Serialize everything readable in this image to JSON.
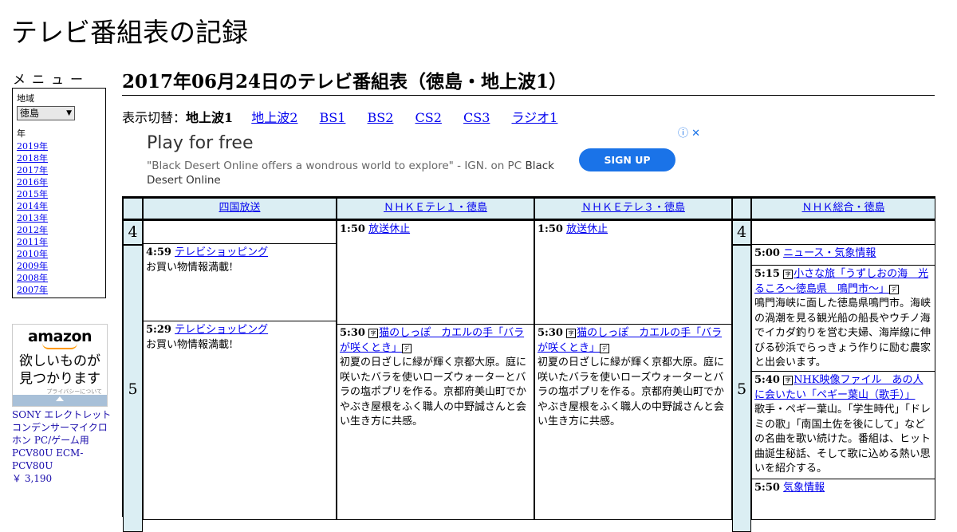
{
  "site": {
    "title": "テレビ番組表の記録"
  },
  "menu": {
    "label": "メニュー",
    "region_label": "地域",
    "region_value": "徳島",
    "year_label": "年",
    "years": [
      "2019年",
      "2018年",
      "2017年",
      "2016年",
      "2015年",
      "2014年",
      "2013年",
      "2012年",
      "2011年",
      "2010年",
      "2009年",
      "2008年",
      "2007年"
    ]
  },
  "amazon_ad": {
    "logo": "amazon",
    "tagline_1": "欲しいものが",
    "tagline_2": "見つかります",
    "privacy": "プライバシーについて",
    "product_name": "SONY エレクトレットコンデンサーマイクロホン PC/ゲーム用 PCV80U ECM-PCV80U",
    "product_price": "￥ 3,190"
  },
  "page": {
    "heading": "2017年06月24日のテレビ番組表（徳島・地上波1）"
  },
  "switcher": {
    "label": "表示切替：",
    "current": "地上波1",
    "links": [
      "地上波2",
      "BS1",
      "BS2",
      "CS2",
      "CS3",
      "ラジオ1"
    ]
  },
  "ad": {
    "headline": "Play for free",
    "text": "\"Black Desert Online offers a wondrous world to explore\" - IGN. on PC",
    "text_brand": "Black Desert Online",
    "button": "SIGN UP",
    "info_icon": "info-icon",
    "close_icon": "close-icon"
  },
  "schedule": {
    "channels": [
      "四国放送",
      "ＮＨＫＥテレ１・徳島",
      "ＮＨＫＥテレ３・徳島",
      "ＮＨＫ総合・徳島"
    ],
    "hours": [
      "4",
      "5"
    ],
    "programs": {
      "p1": {
        "time": "4:59",
        "title": "テレビショッピング",
        "desc": "お買い物情報満載!"
      },
      "p2": {
        "time": "5:29",
        "title": "テレビショッピング",
        "desc": "お買い物情報満載!"
      },
      "p3": {
        "time": "1:50",
        "title": "放送休止"
      },
      "p4": {
        "time": "5:30",
        "title": "猫のしっぽ　カエルの手「バラが咲くとき」",
        "desc": "初夏の日ざしに緑が輝く京都大原。庭に咲いたバラを使いローズウォーターとバラの塩ポプリを作る。京都府美山町でかやぶき屋根をふく職人の中野誠さんと会い生き方に共感。"
      },
      "p5": {
        "time": "1:50",
        "title": "放送休止"
      },
      "p6": {
        "time": "5:30",
        "title": "猫のしっぽ　カエルの手「バラが咲くとき」",
        "desc": "初夏の日ざしに緑が輝く京都大原。庭に咲いたバラを使いローズウォーターとバラの塩ポプリを作る。京都府美山町でかやぶき屋根をふく職人の中野誠さんと会い生き方に共感。"
      },
      "p7": {
        "time": "5:00",
        "title": "ニュース・気象情報"
      },
      "p8": {
        "time": "5:15",
        "title": "小さな旅「うずしおの海　光るころ～徳島県　鳴門市～」",
        "desc": "鳴門海峡に面した徳島県鳴門市。海峡の渦潮を見る観光船の船長やウチノ海でイカダ釣りを営む夫婦、海岸線に伸びる砂浜でらっきょう作りに励む農家と出会います。"
      },
      "p9": {
        "time": "5:40",
        "title": "NHK映像ファイル　あの人に会いたい「ペギー葉山（歌手）」",
        "desc": "歌手・ペギー葉山。「学生時代」「ドレミの歌」「南国土佐を後にして」などの名曲を歌い続けた。番組は、ヒット曲誕生秘話、そして歌に込める熱い思いを紹介する。"
      },
      "p10": {
        "time": "5:50",
        "title": "気象情報"
      }
    },
    "marks": {
      "new": "字",
      "data": "デ"
    }
  }
}
